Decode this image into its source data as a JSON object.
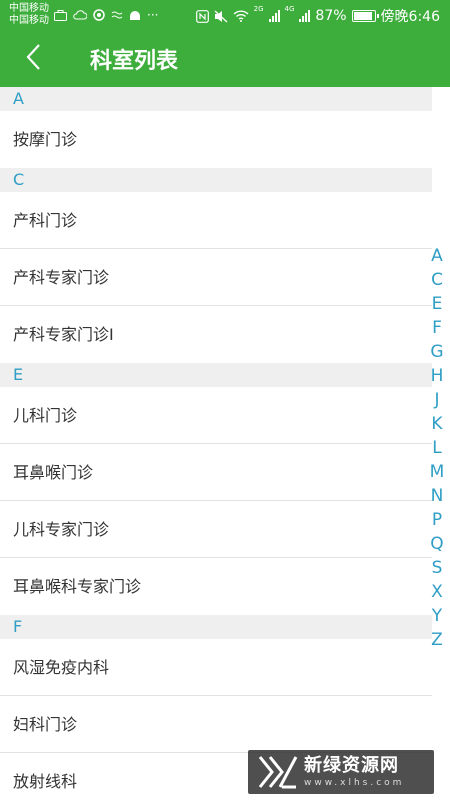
{
  "status_bar": {
    "carrier_1": "中国移动",
    "carrier_2": "中国移动",
    "network_1": "2G",
    "network_2": "4G",
    "battery": "87%",
    "time": "傍晚6:46",
    "more": "···"
  },
  "header": {
    "back_icon": "chevron-left-icon",
    "title": "科室列表"
  },
  "sections": [
    {
      "letter": "A",
      "items": [
        "按摩门诊"
      ]
    },
    {
      "letter": "C",
      "items": [
        "产科门诊",
        "产科专家门诊",
        "产科专家门诊I"
      ]
    },
    {
      "letter": "E",
      "items": [
        "儿科门诊",
        "耳鼻喉门诊",
        "儿科专家门诊",
        "耳鼻喉科专家门诊"
      ]
    },
    {
      "letter": "F",
      "items": [
        "风湿免疫内科",
        "妇科门诊",
        "放射线科"
      ]
    }
  ],
  "index_letters": [
    "A",
    "C",
    "E",
    "F",
    "G",
    "H",
    "J",
    "K",
    "L",
    "M",
    "N",
    "P",
    "Q",
    "S",
    "X",
    "Y",
    "Z"
  ],
  "watermark": {
    "main": "新绿资源网",
    "sub": "www.xlhs.com"
  },
  "colors": {
    "header_green": "#3dad3c",
    "accent_blue": "#2f9ec5"
  }
}
